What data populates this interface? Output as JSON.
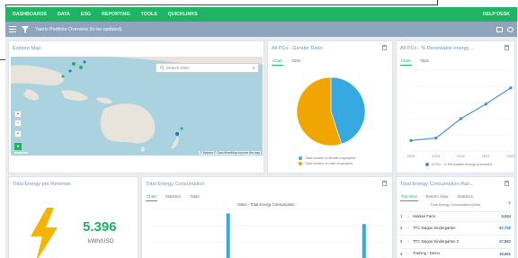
{
  "nav": {
    "items": [
      "DASHBOARDS",
      "DATA",
      "ESG",
      "REPORTING",
      "TOOLS",
      "QUICKLINKS"
    ],
    "help": "HELP DESK"
  },
  "subbar": {
    "title": "Yaeris Portfolio Overview (to be updated)"
  },
  "explore_map": {
    "title": "Explore Map",
    "search_placeholder": "Search Sites",
    "attribution": "© Mapbox © OpenStreetMap Improve this map",
    "logo": "mapbox"
  },
  "gender_ratio": {
    "title": "All PCs - Gender Ratio",
    "tabs": [
      "Chart",
      "Table"
    ],
    "legend": [
      "Total number of female employees",
      "Total number of male employees"
    ]
  },
  "renewable": {
    "title": "All PCs - % Renewable energy ...",
    "tabs": [
      "Chart",
      "Table"
    ],
    "legend": "Δ PCs - % Renewable energy purchased"
  },
  "energy_revenue": {
    "title": "Total Energy per Revenue",
    "value": "5.396",
    "unit": "kWh/USD"
  },
  "energy_consumption": {
    "title": "Total Energy Consumption",
    "tabs": [
      "Chart",
      "Statistics",
      "Table"
    ],
    "chart_title": "Solen - Total Energy Consumption -"
  },
  "ranking": {
    "title": "Total Energy Consumption Ran...",
    "tabs": [
      "Top View",
      "Bottom View",
      "Statistics"
    ],
    "header": "Total Energy Consumption (kWh)",
    "rows": [
      {
        "rank": "1",
        "name": "Hukkee Farm",
        "value": "5,564"
      },
      {
        "rank": "2",
        "name": "TTC Saigon Kindergarten",
        "value": "87,750"
      },
      {
        "rank": "3",
        "name": "TTC Saigon Kindergarten 2",
        "value": "57,862"
      },
      {
        "rank": "4",
        "name": "Training - Demo",
        "value": "40,851"
      }
    ]
  },
  "colors": {
    "nav_green": "#1fb463",
    "subbar": "#8fa4bd",
    "pie_blue": "#36a9e1",
    "pie_orange": "#f0a500",
    "line_blue": "#4a90d9",
    "kpi_green": "#1fb463",
    "bolt": "#f4b400"
  },
  "chart_data": [
    {
      "type": "pie",
      "categories": [
        "Total number of female employees",
        "Total number of male employees"
      ],
      "values": [
        45,
        55
      ]
    },
    {
      "type": "line",
      "x": [
        "2018",
        "2019",
        "2020",
        "2021",
        "2022"
      ],
      "series": [
        {
          "name": "Δ PCs - % Renewable energy purchased",
          "values": [
            13,
            16,
            40,
            58,
            78
          ]
        }
      ],
      "ylim": [
        0,
        100
      ],
      "grid": true
    },
    {
      "type": "bar",
      "series": [
        {
          "values": [
            0,
            0,
            0,
            0,
            0,
            0,
            0,
            0,
            92,
            0,
            0,
            0,
            0,
            0,
            0,
            0,
            0,
            0,
            0,
            0,
            0,
            0,
            0,
            71,
            0,
            0
          ]
        }
      ],
      "ylim": [
        0,
        100
      ]
    }
  ]
}
